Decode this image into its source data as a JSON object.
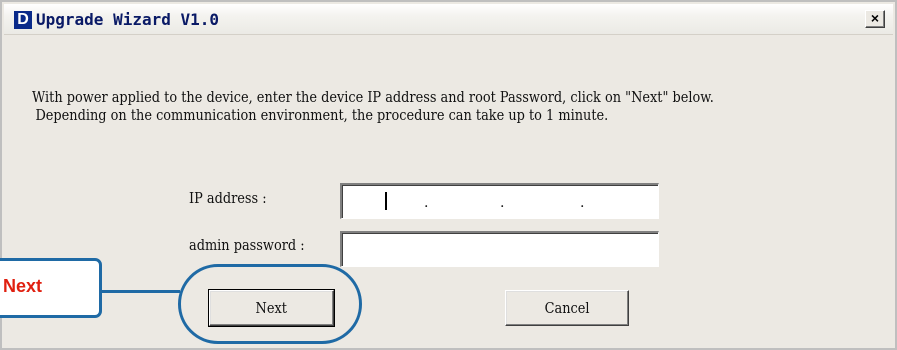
{
  "window": {
    "title": "Upgrade Wizard V1.0",
    "logo_letter": "D",
    "close_symbol": "×"
  },
  "message": {
    "line1": "With power applied to the device, enter the device IP address and root Password, click on \"Next\" below.",
    "line2": "Depending on the communication environment, the procedure can take up to 1 minute."
  },
  "form": {
    "ip_label": "IP address :",
    "ip_value": ".         .         .",
    "password_label": "admin password :",
    "password_value": ""
  },
  "buttons": {
    "next_label": "Next",
    "cancel_label": "Cancel"
  },
  "callout": {
    "text": "Next"
  },
  "colors": {
    "callout_border": "#1f6aa5",
    "callout_text": "#e02010",
    "title_text": "#0a1a66"
  }
}
